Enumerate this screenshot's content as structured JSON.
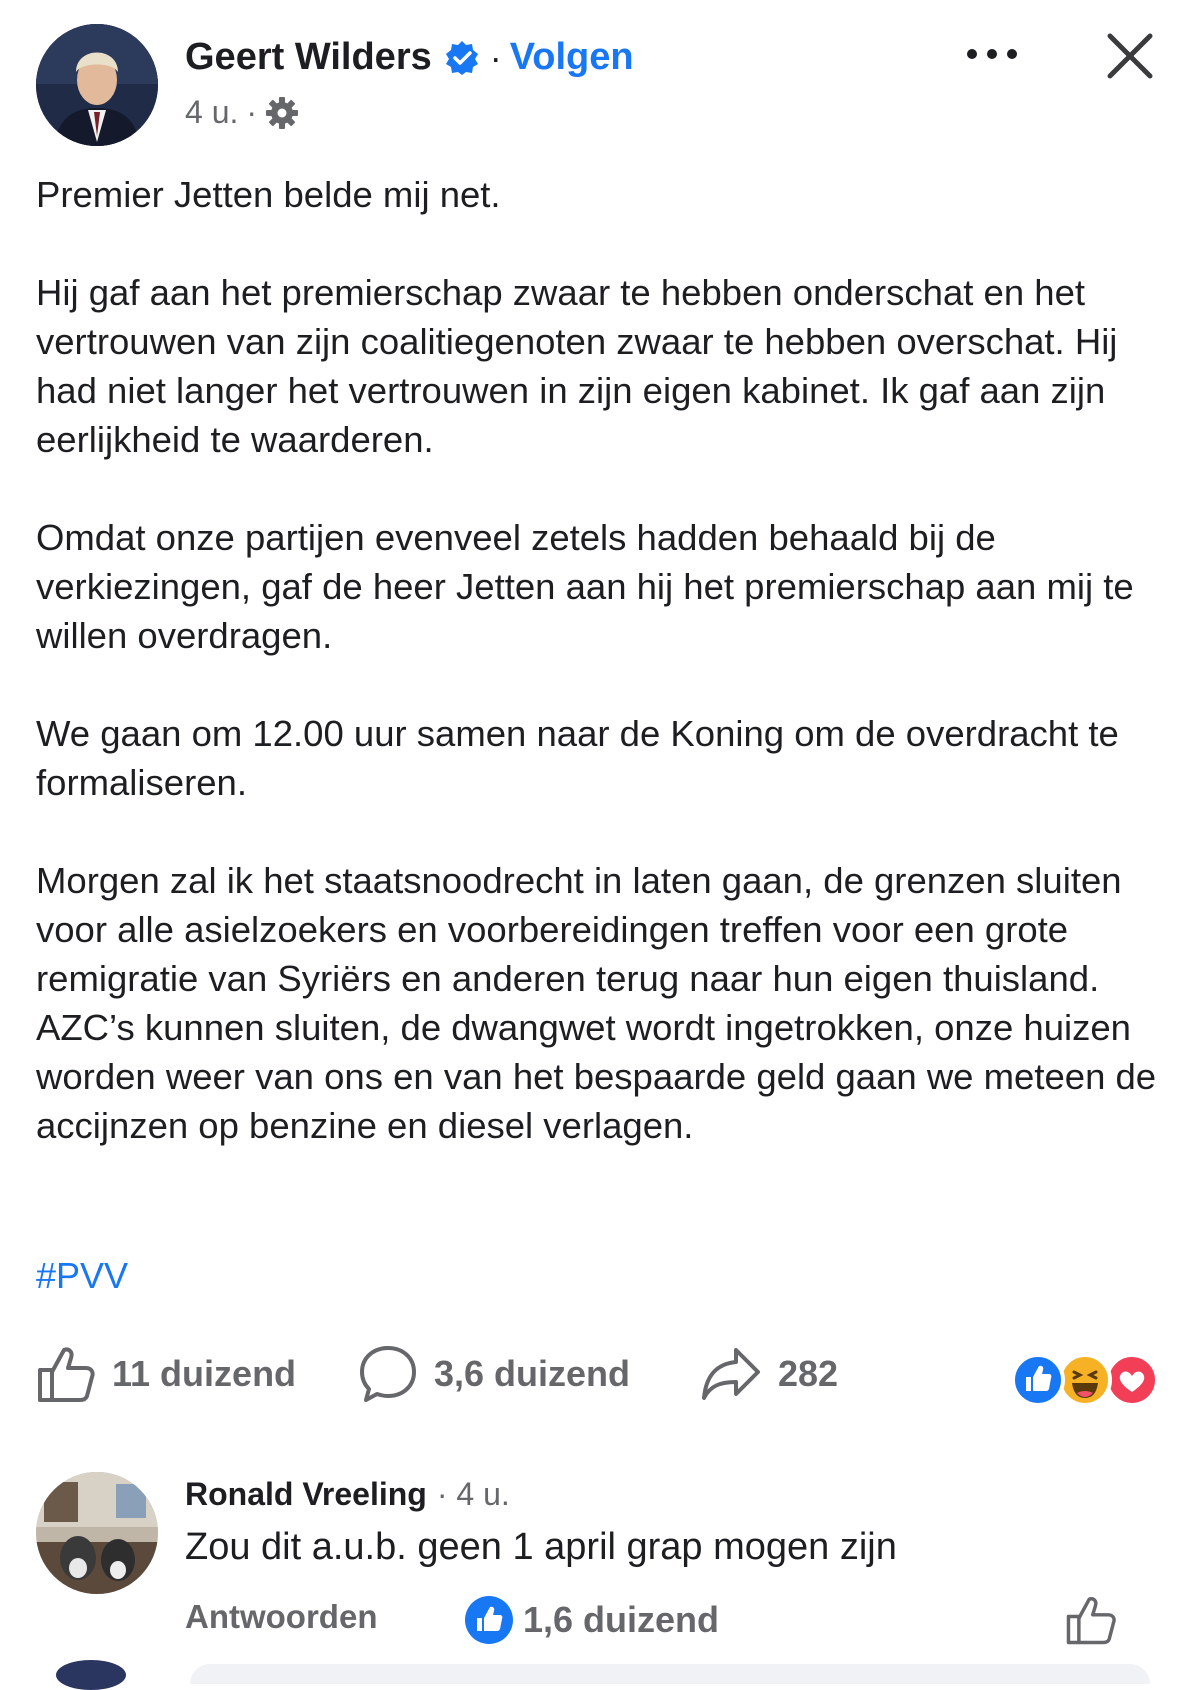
{
  "post": {
    "author": "Geert Wilders",
    "follow_label": "Volgen",
    "separator": "·",
    "time": "4 u.",
    "paragraphs": [
      "Premier Jetten belde mij net.",
      "Hij gaf aan het premierschap zwaar te hebben onderschat en het vertrouwen van zijn coalitiegenoten zwaar te hebben overschat. Hij had niet langer het vertrouwen in zijn eigen kabinet. Ik gaf aan zijn eerlijkheid te waarderen.",
      "Omdat onze partijen evenveel zetels hadden behaald bij de verkiezingen, gaf de heer Jetten aan hij het premierschap aan mij te willen overdragen.",
      "We gaan om 12.00 uur samen naar de Koning om de overdracht te formaliseren.",
      "Morgen zal ik het staatsnoodrecht in laten gaan, de grenzen sluiten voor alle asielzoekers en voorbereidingen treffen voor een grote remigratie van Syriërs en anderen terug naar hun eigen thuisland. AZC’s kunnen sluiten, de dwangwet wordt ingetrokken, onze huizen worden weer van ons en van het bespaarde geld gaan we meteen de accijnzen op benzine en diesel verlagen."
    ],
    "hashtag": "#PVV"
  },
  "stats": {
    "likes": "11 duizend",
    "comments": "3,6 duizend",
    "shares": "282"
  },
  "reaction_icons": [
    "like-icon",
    "haha-icon",
    "love-icon"
  ],
  "comment": {
    "author": "Ronald Vreeling",
    "time": "· 4 u.",
    "text": "Zou dit a.u.b. geen 1 april grap mogen zijn",
    "reply_label": "Antwoorden",
    "likes": "1,6 duizend"
  },
  "colors": {
    "accent": "#1877f2",
    "text": "#1c1e21",
    "secondary": "#65676b",
    "love": "#f33e58",
    "haha": "#f7b125"
  }
}
